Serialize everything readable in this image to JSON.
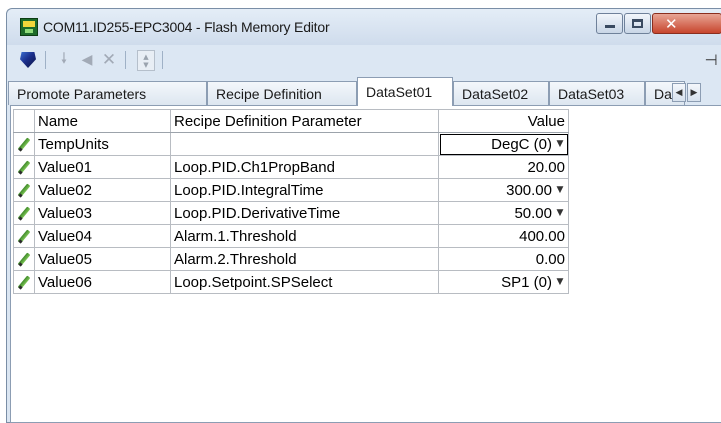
{
  "window": {
    "title": "COM11.ID255-EPC3004 - Flash Memory Editor",
    "buttons": {
      "minimize": "minimize",
      "maximize": "maximize",
      "close": "close"
    }
  },
  "toolbar": {
    "icons": [
      "gem-icon",
      "arrow-down-icon",
      "arrow-left-icon",
      "delete-icon",
      "spin-icon",
      "pin-icon"
    ]
  },
  "tabs": [
    {
      "label": "Promote Parameters",
      "active": false
    },
    {
      "label": "Recipe Definition",
      "active": false
    },
    {
      "label": "DataSet01",
      "active": true
    },
    {
      "label": "DataSet02",
      "active": false
    },
    {
      "label": "DataSet03",
      "active": false
    },
    {
      "label": "Da",
      "active": false
    }
  ],
  "grid": {
    "headers": {
      "name": "Name",
      "definition": "Recipe Definition Parameter",
      "value": "Value"
    },
    "rows": [
      {
        "name": "TempUnits",
        "definition": "",
        "value": "DegC (0)",
        "dropdown": true,
        "focused": true
      },
      {
        "name": "Value01",
        "definition": "Loop.PID.Ch1PropBand",
        "value": "20.00",
        "dropdown": false
      },
      {
        "name": "Value02",
        "definition": "Loop.PID.IntegralTime",
        "value": "300.00",
        "dropdown": true
      },
      {
        "name": "Value03",
        "definition": "Loop.PID.DerivativeTime",
        "value": "50.00",
        "dropdown": true
      },
      {
        "name": "Value04",
        "definition": "Alarm.1.Threshold",
        "value": "400.00",
        "dropdown": false
      },
      {
        "name": "Value05",
        "definition": "Alarm.2.Threshold",
        "value": "0.00",
        "dropdown": false
      },
      {
        "name": "Value06",
        "definition": "Loop.Setpoint.SPSelect",
        "value": "SP1 (0)",
        "dropdown": true
      }
    ]
  },
  "colors": {
    "chrome": "#dce7f3",
    "close_button": "#c7452d",
    "pencil": "#3f8a2a"
  }
}
